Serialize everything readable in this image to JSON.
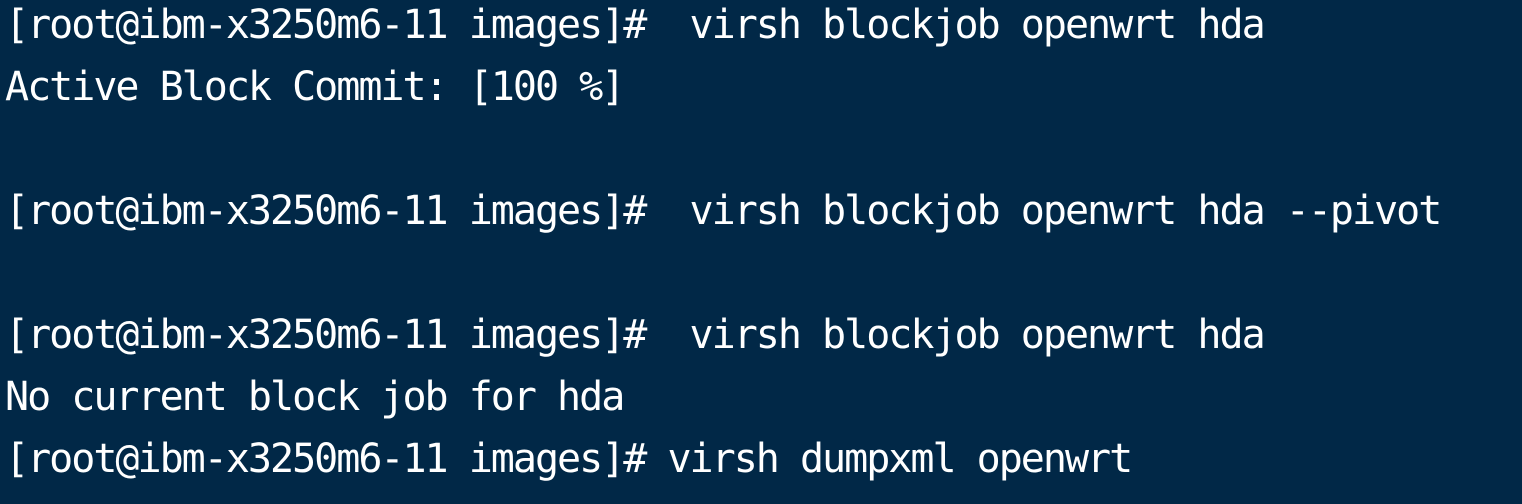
{
  "terminal": {
    "lines": [
      "[root@ibm-x3250m6-11 images]#  virsh blockjob openwrt hda",
      "Active Block Commit: [100 %]",
      "",
      "[root@ibm-x3250m6-11 images]#  virsh blockjob openwrt hda --pivot",
      "",
      "[root@ibm-x3250m6-11 images]#  virsh blockjob openwrt hda",
      "No current block job for hda",
      "[root@ibm-x3250m6-11 images]# virsh dumpxml openwrt"
    ]
  },
  "colors": {
    "background": "#012847",
    "text": "#ffffff"
  }
}
